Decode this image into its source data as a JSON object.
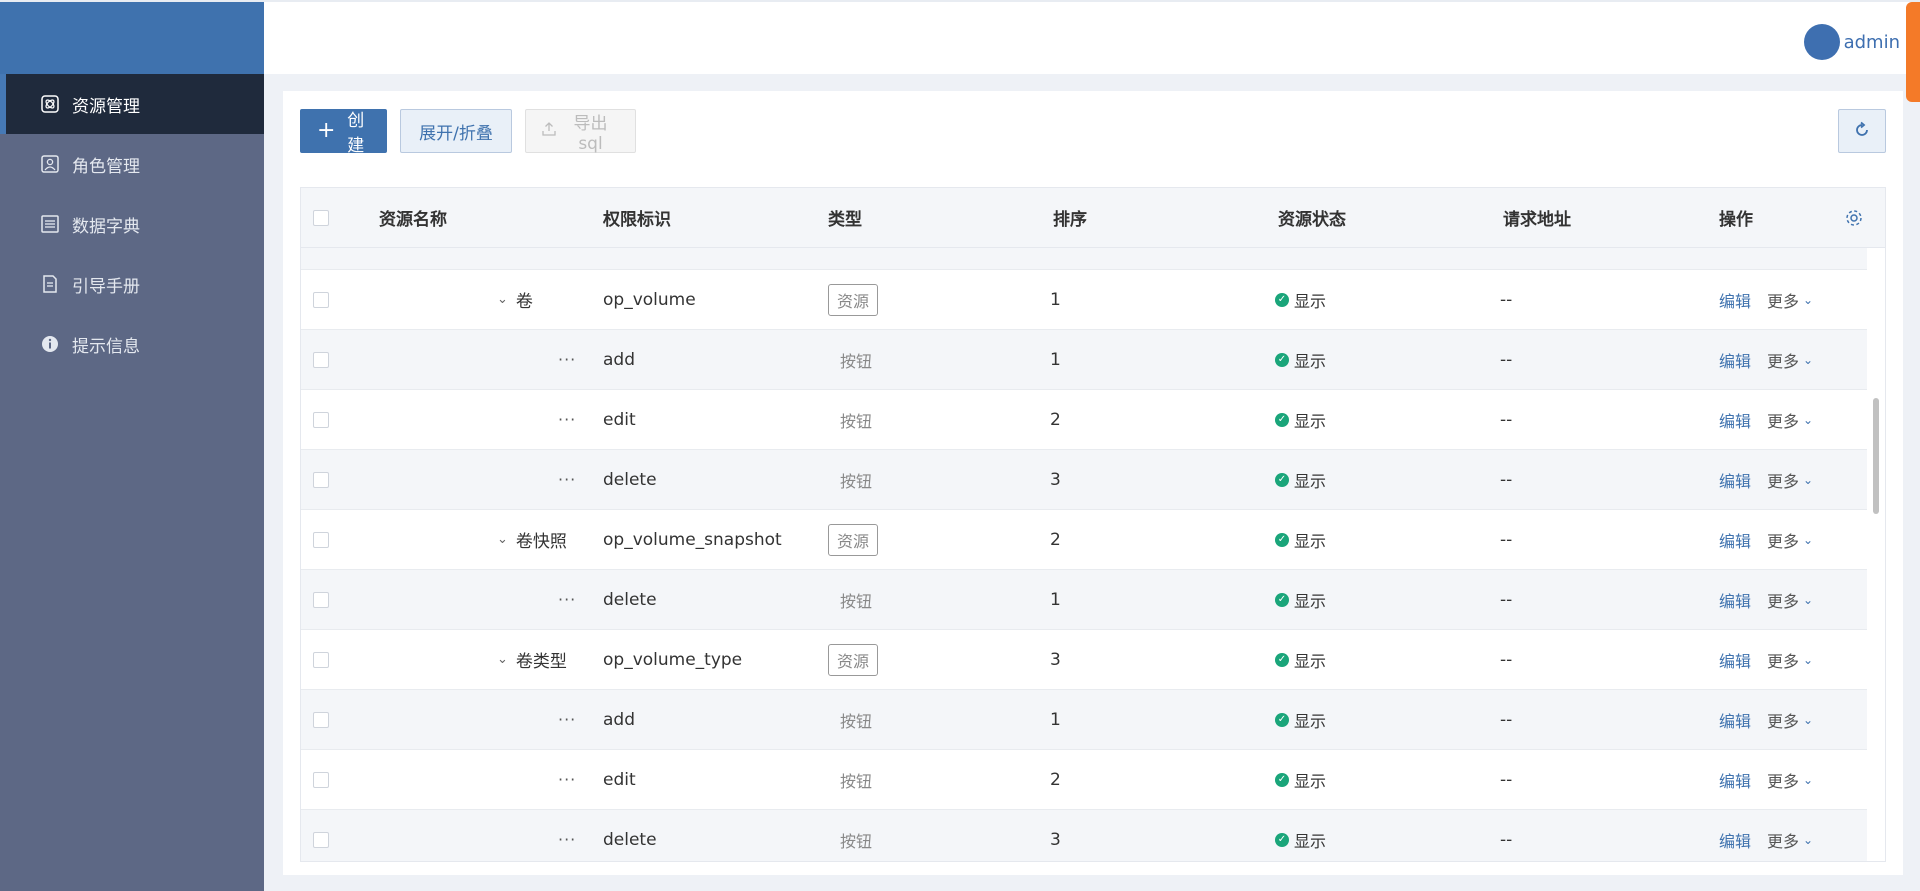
{
  "sidebar": {
    "items": [
      {
        "label": "资源管理",
        "icon": "atom-icon",
        "active": true
      },
      {
        "label": "角色管理",
        "icon": "user-card-icon",
        "active": false
      },
      {
        "label": "数据字典",
        "icon": "list-icon",
        "active": false
      },
      {
        "label": "引导手册",
        "icon": "document-icon",
        "active": false
      },
      {
        "label": "提示信息",
        "icon": "info-icon",
        "active": false
      }
    ]
  },
  "header": {
    "username": "admin"
  },
  "toolbar": {
    "create_label": "创建",
    "expand_label": "展开/折叠",
    "export_label": "导出sql"
  },
  "table": {
    "columns": {
      "name": "资源名称",
      "permission": "权限标识",
      "type": "类型",
      "order": "排序",
      "status": "资源状态",
      "url": "请求地址",
      "actions": "操作"
    },
    "rows": [
      {
        "kind": "resource",
        "name": "卷",
        "permission": "op_volume",
        "type": "资源",
        "order": "1",
        "status": "显示",
        "url": "--"
      },
      {
        "kind": "button",
        "name": "···",
        "permission": "add",
        "type": "按钮",
        "order": "1",
        "status": "显示",
        "url": "--"
      },
      {
        "kind": "button",
        "name": "···",
        "permission": "edit",
        "type": "按钮",
        "order": "2",
        "status": "显示",
        "url": "--"
      },
      {
        "kind": "button",
        "name": "···",
        "permission": "delete",
        "type": "按钮",
        "order": "3",
        "status": "显示",
        "url": "--"
      },
      {
        "kind": "resource",
        "name": "卷快照",
        "permission": "op_volume_snapshot",
        "type": "资源",
        "order": "2",
        "status": "显示",
        "url": "--"
      },
      {
        "kind": "button",
        "name": "···",
        "permission": "delete",
        "type": "按钮",
        "order": "1",
        "status": "显示",
        "url": "--"
      },
      {
        "kind": "resource",
        "name": "卷类型",
        "permission": "op_volume_type",
        "type": "资源",
        "order": "3",
        "status": "显示",
        "url": "--"
      },
      {
        "kind": "button",
        "name": "···",
        "permission": "add",
        "type": "按钮",
        "order": "1",
        "status": "显示",
        "url": "--"
      },
      {
        "kind": "button",
        "name": "···",
        "permission": "edit",
        "type": "按钮",
        "order": "2",
        "status": "显示",
        "url": "--"
      },
      {
        "kind": "button",
        "name": "···",
        "permission": "delete",
        "type": "按钮",
        "order": "3",
        "status": "显示",
        "url": "--"
      }
    ],
    "edit_label": "编辑",
    "more_label": "更多"
  },
  "colors": {
    "primary": "#3f72ae",
    "sidebar": "#5d6885",
    "sidebar_active": "#1f2a3c",
    "status_ok": "#1aa57a",
    "accent_tab": "#f47a28"
  }
}
